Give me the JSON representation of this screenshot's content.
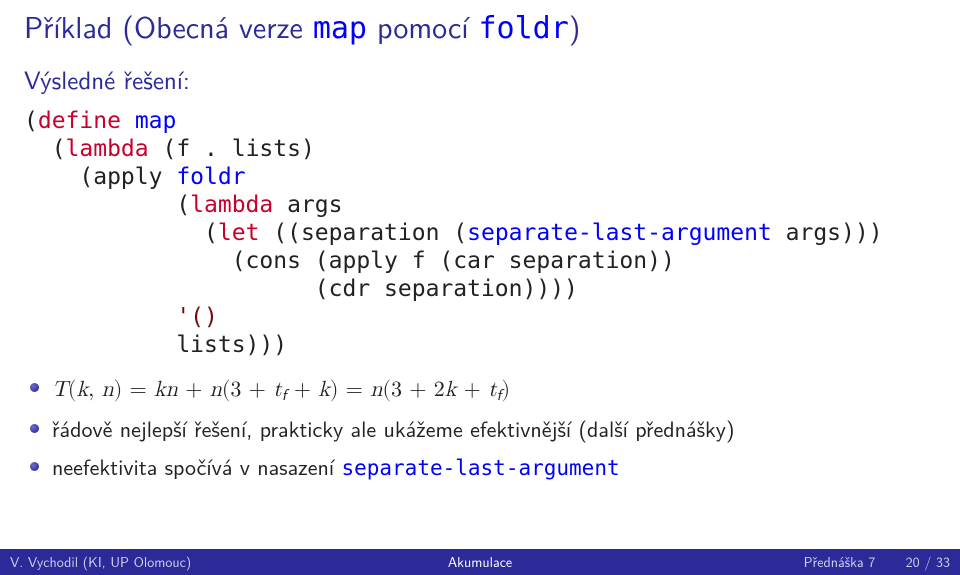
{
  "heading": {
    "prefix": "Příklad (Obecná verze ",
    "code1": "map",
    "middle": " pomocí ",
    "code2": "foldr",
    "suffix": ")"
  },
  "subtitle": "Výsledné řešení:",
  "code": {
    "l01a": "(",
    "l01b": "define",
    "l01c": " ",
    "l01d": "map",
    "l02a": "  (",
    "l02b": "lambda",
    "l02c": " (f . lists)",
    "l03a": "    (apply ",
    "l03b": "foldr",
    "l04a": "           (",
    "l04b": "lambda",
    "l04c": " args",
    "l05a": "             (",
    "l05b": "let",
    "l05c": " ((separation (",
    "l05d": "separate-last-argument",
    "l05e": " args)))",
    "l06": "               (cons (apply f (car separation))",
    "l07": "                     (cdr separation))))",
    "l08a": "           ",
    "l08b": "'()",
    "l09": "           lists)))"
  },
  "bullets": [
    {
      "math": {
        "lhs_T": "T",
        "lhs_open": "(",
        "lhs_k": "k",
        "lhs_comma": ", ",
        "lhs_n": "n",
        "lhs_close": ") = ",
        "r1_kn": "kn",
        "plus": " + ",
        "r1_n": "n",
        "r1_open": "(3 + ",
        "r1_tf_t": "t",
        "r1_tf_f": "f",
        "r1_mid": " + ",
        "r1_k": "k",
        "r1_close": ") = ",
        "r2_n": "n",
        "r2_open": "(3 + 2",
        "r2_k": "k",
        "r2_mid": " + ",
        "r2_tf_t": "t",
        "r2_tf_f": "f",
        "r2_close": ")"
      }
    },
    {
      "text": "řádově nejlepší řešení, prakticky ale ukážeme efektivnější (další přednášky)"
    },
    {
      "prefix": "neefektivita spočívá v nasazení ",
      "tt": "separate-last-argument"
    }
  ],
  "footer": {
    "left": "V. Vychodil (KI, UP Olomouc)",
    "mid": "Akumulace",
    "right_label": "Přednáška 7",
    "right_page": "20 / 33"
  }
}
